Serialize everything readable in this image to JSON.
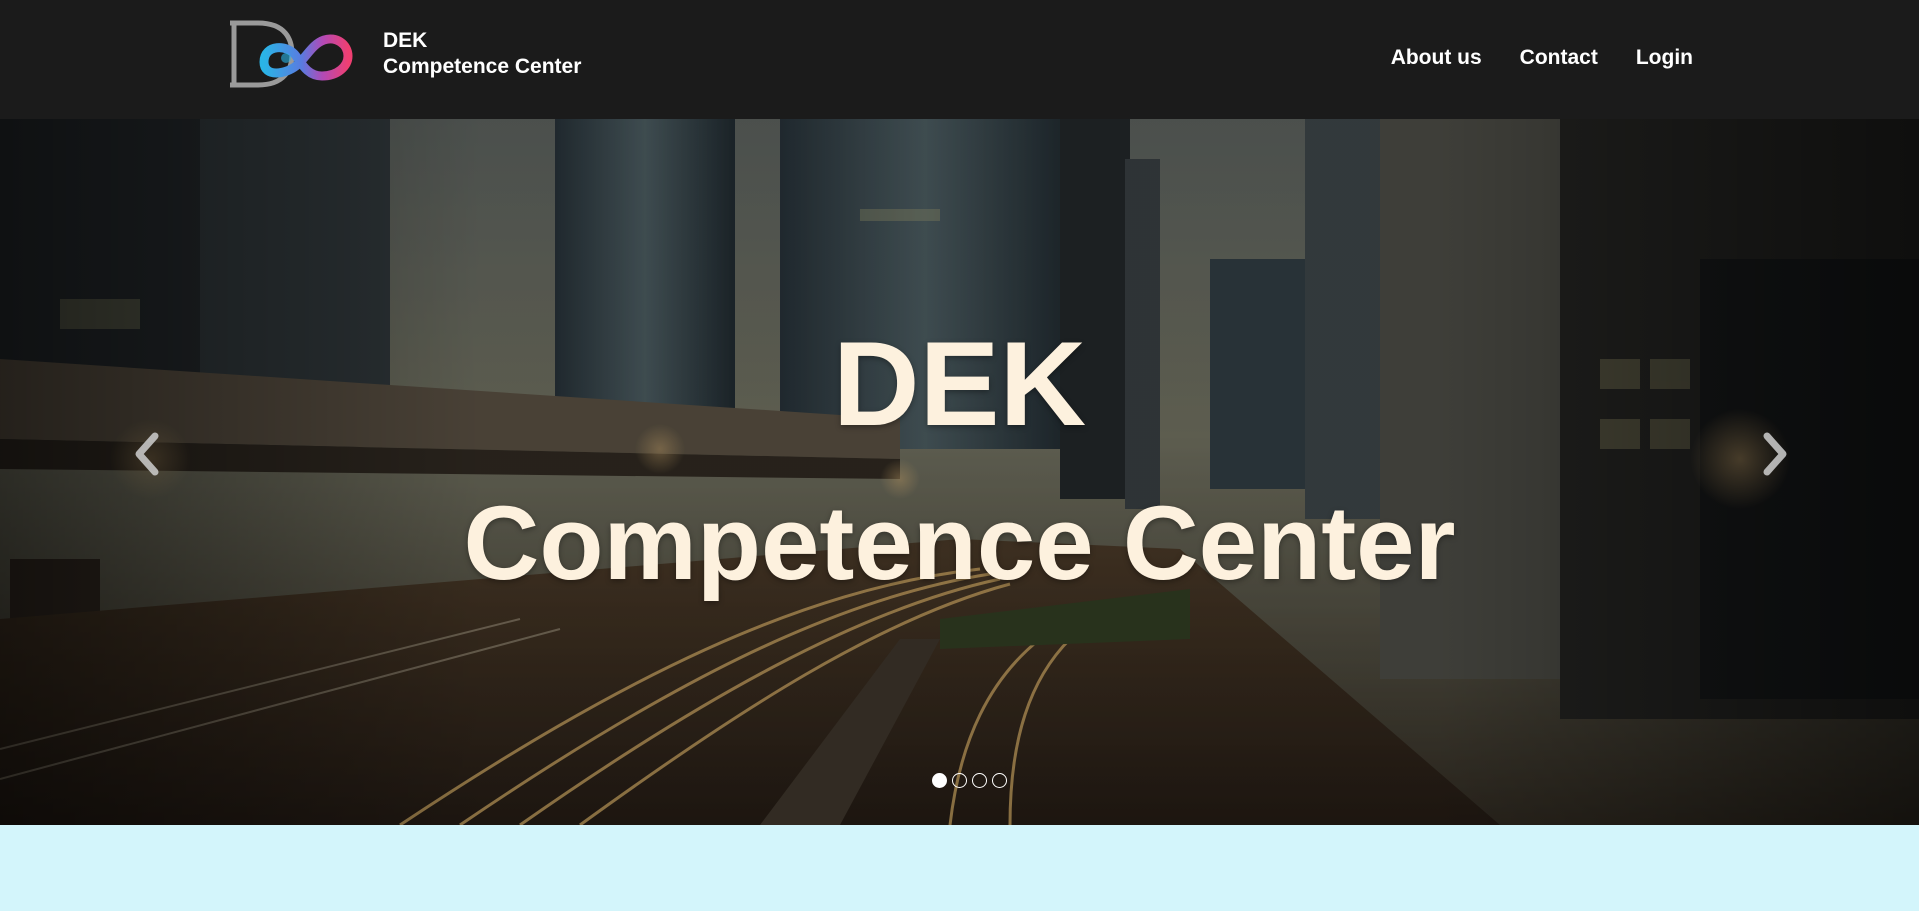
{
  "navbar": {
    "brand": {
      "line1": "DEK",
      "line2": "Competence Center",
      "logo_icon": "dek-logo-icon"
    },
    "links": [
      {
        "label": "About us"
      },
      {
        "label": "Contact"
      },
      {
        "label": "Login"
      }
    ]
  },
  "hero": {
    "background": "city-highway-night-photo",
    "title_line1": "DEK",
    "title_line2": "Competence Center",
    "prev_icon": "chevron-left-icon",
    "next_icon": "chevron-right-icon",
    "slide_count": 4,
    "active_slide": 1
  },
  "colors": {
    "navbar_bg": "#1b1b1b",
    "hero_title": "#fdf1de",
    "below_section_bg": "#d3f5fb"
  }
}
